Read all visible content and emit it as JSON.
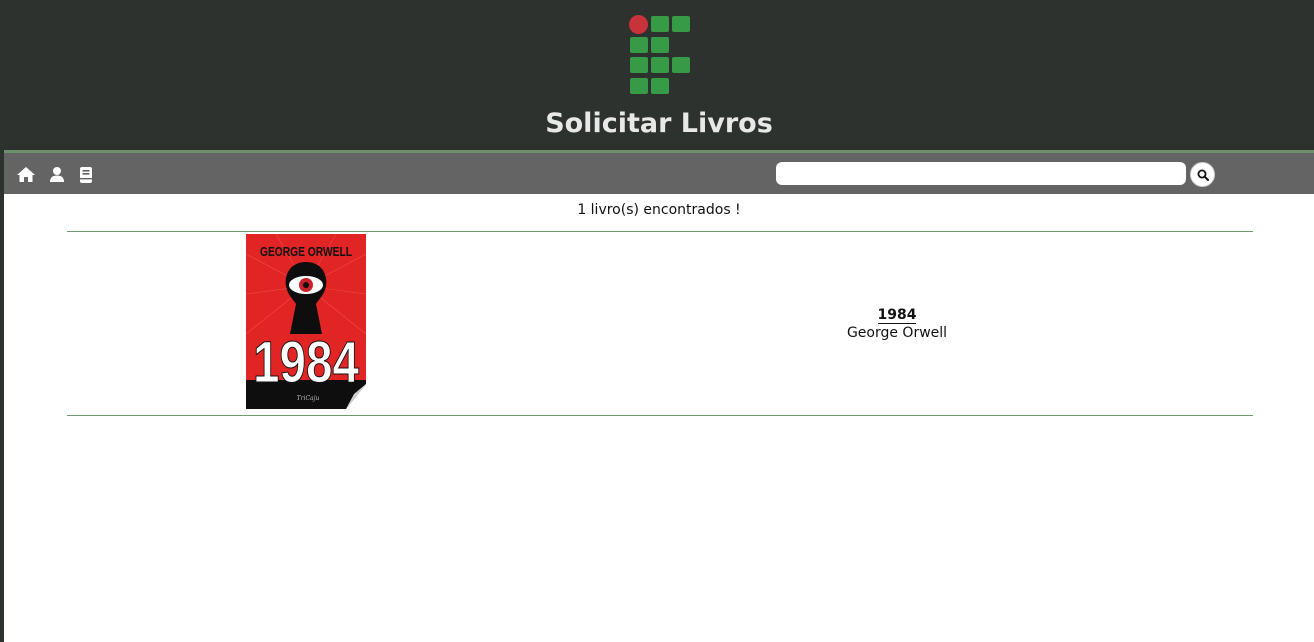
{
  "header": {
    "title": "Solicitar Livros"
  },
  "navbar": {
    "icons": [
      "home-icon",
      "user-icon",
      "book-icon"
    ],
    "search": {
      "value": "",
      "placeholder": ""
    },
    "search_button_icon": "search-icon"
  },
  "results": {
    "count_text": "1 livro(s) encontrados !",
    "books": [
      {
        "title": "1984",
        "author": "George Orwell",
        "cover": {
          "author_text": "GEORGE ORWELL",
          "title_text": "1984",
          "publisher_text": "TriCaju"
        }
      }
    ]
  },
  "colors": {
    "header_bg": "#2e322f",
    "navbar_bg": "#646464",
    "logo_green": "#379a47",
    "logo_red": "#c8323a",
    "divider": "#6d9a6e",
    "cover_red": "#e12424"
  }
}
